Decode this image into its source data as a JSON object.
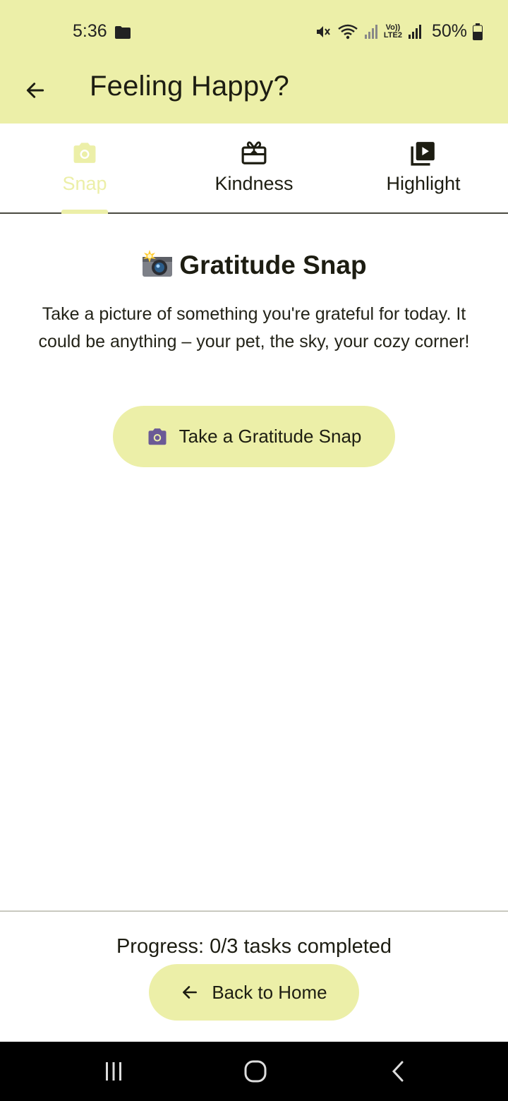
{
  "status_bar": {
    "time": "5:36",
    "battery": "50%",
    "icons": [
      "folder-icon",
      "mute-icon",
      "wifi-icon",
      "signal-icon",
      "volte-icon",
      "signal-icon",
      "battery-icon"
    ],
    "volte_label_top": "Vo))",
    "volte_label_bottom": "LTE2"
  },
  "app_bar": {
    "title": "Feeling Happy?",
    "back_icon": "arrow-left-icon"
  },
  "tabs": [
    {
      "label": "Snap",
      "icon": "camera-icon",
      "active": true
    },
    {
      "label": "Kindness",
      "icon": "gift-card-icon",
      "active": false
    },
    {
      "label": "Highlight",
      "icon": "video-library-icon",
      "active": false
    }
  ],
  "content": {
    "title_emoji": "📸",
    "title": "Gratitude Snap",
    "description": "Take a picture of something you're grateful for today. It could be anything – your pet, the sky, your cozy corner!",
    "button_label": "Take a Gratitude Snap",
    "button_icon": "camera-icon"
  },
  "footer": {
    "progress": "Progress: 0/3 tasks completed",
    "home_button_label": "Back to Home",
    "home_button_icon": "arrow-left-icon"
  },
  "system_nav": {
    "buttons": [
      "recents-icon",
      "home-icon",
      "back-icon"
    ]
  },
  "colors": {
    "accent": "#ecefa8",
    "icon_purple": "#6b5a96",
    "text": "#1d1d12"
  }
}
